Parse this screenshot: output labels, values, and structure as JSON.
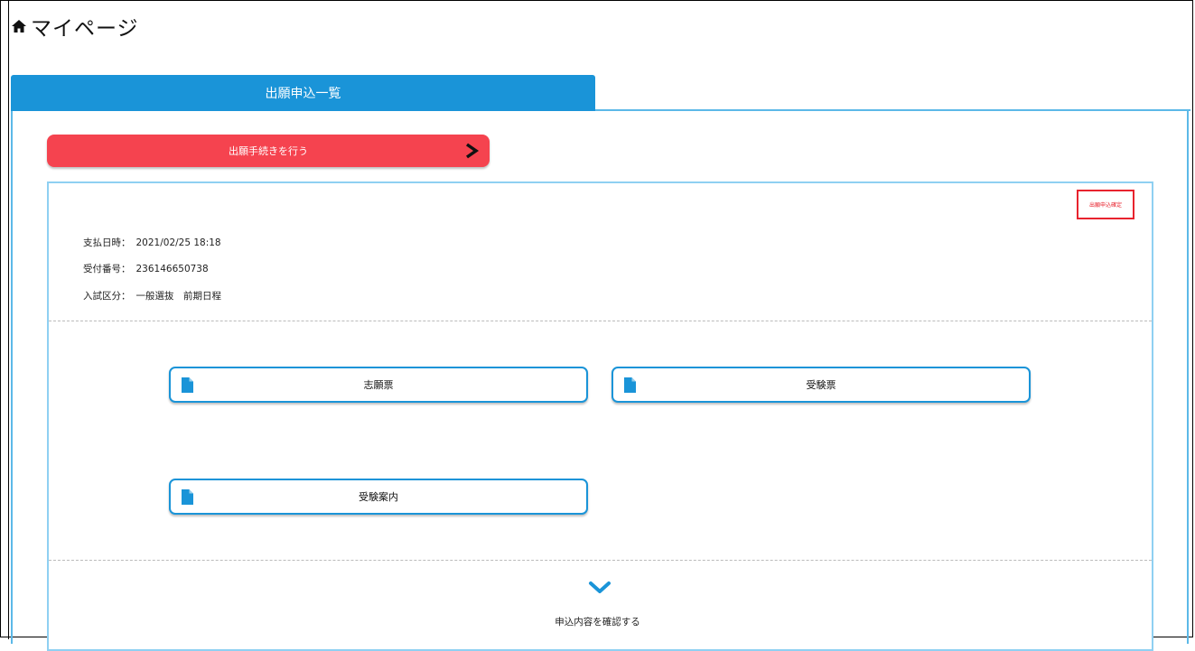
{
  "header": {
    "title": "マイページ",
    "icon": "home-icon"
  },
  "tab": {
    "label": "出願申込一覧"
  },
  "apply_button": {
    "label": "出願手続きを行う",
    "icon": "chevron-right-icon"
  },
  "application": {
    "status_badge": "出願申込確定",
    "fields": [
      {
        "label": "支払日時：",
        "value": "2021/02/25 18:18"
      },
      {
        "label": "受付番号：",
        "value": "236146650738"
      },
      {
        "label": "入試区分：",
        "value": "一般選抜　前期日程"
      }
    ],
    "documents": [
      {
        "label": "志願票",
        "icon": "document-icon"
      },
      {
        "label": "受験票",
        "icon": "document-icon"
      },
      {
        "label": "受験案内",
        "icon": "document-icon"
      }
    ],
    "expand": {
      "label": "申込内容を確認する",
      "icon": "chevron-down-icon"
    }
  },
  "colors": {
    "accent": "#1a94d8",
    "apply": "#f5434f",
    "badge": "#e8232e",
    "border": "#8fd0f2"
  }
}
